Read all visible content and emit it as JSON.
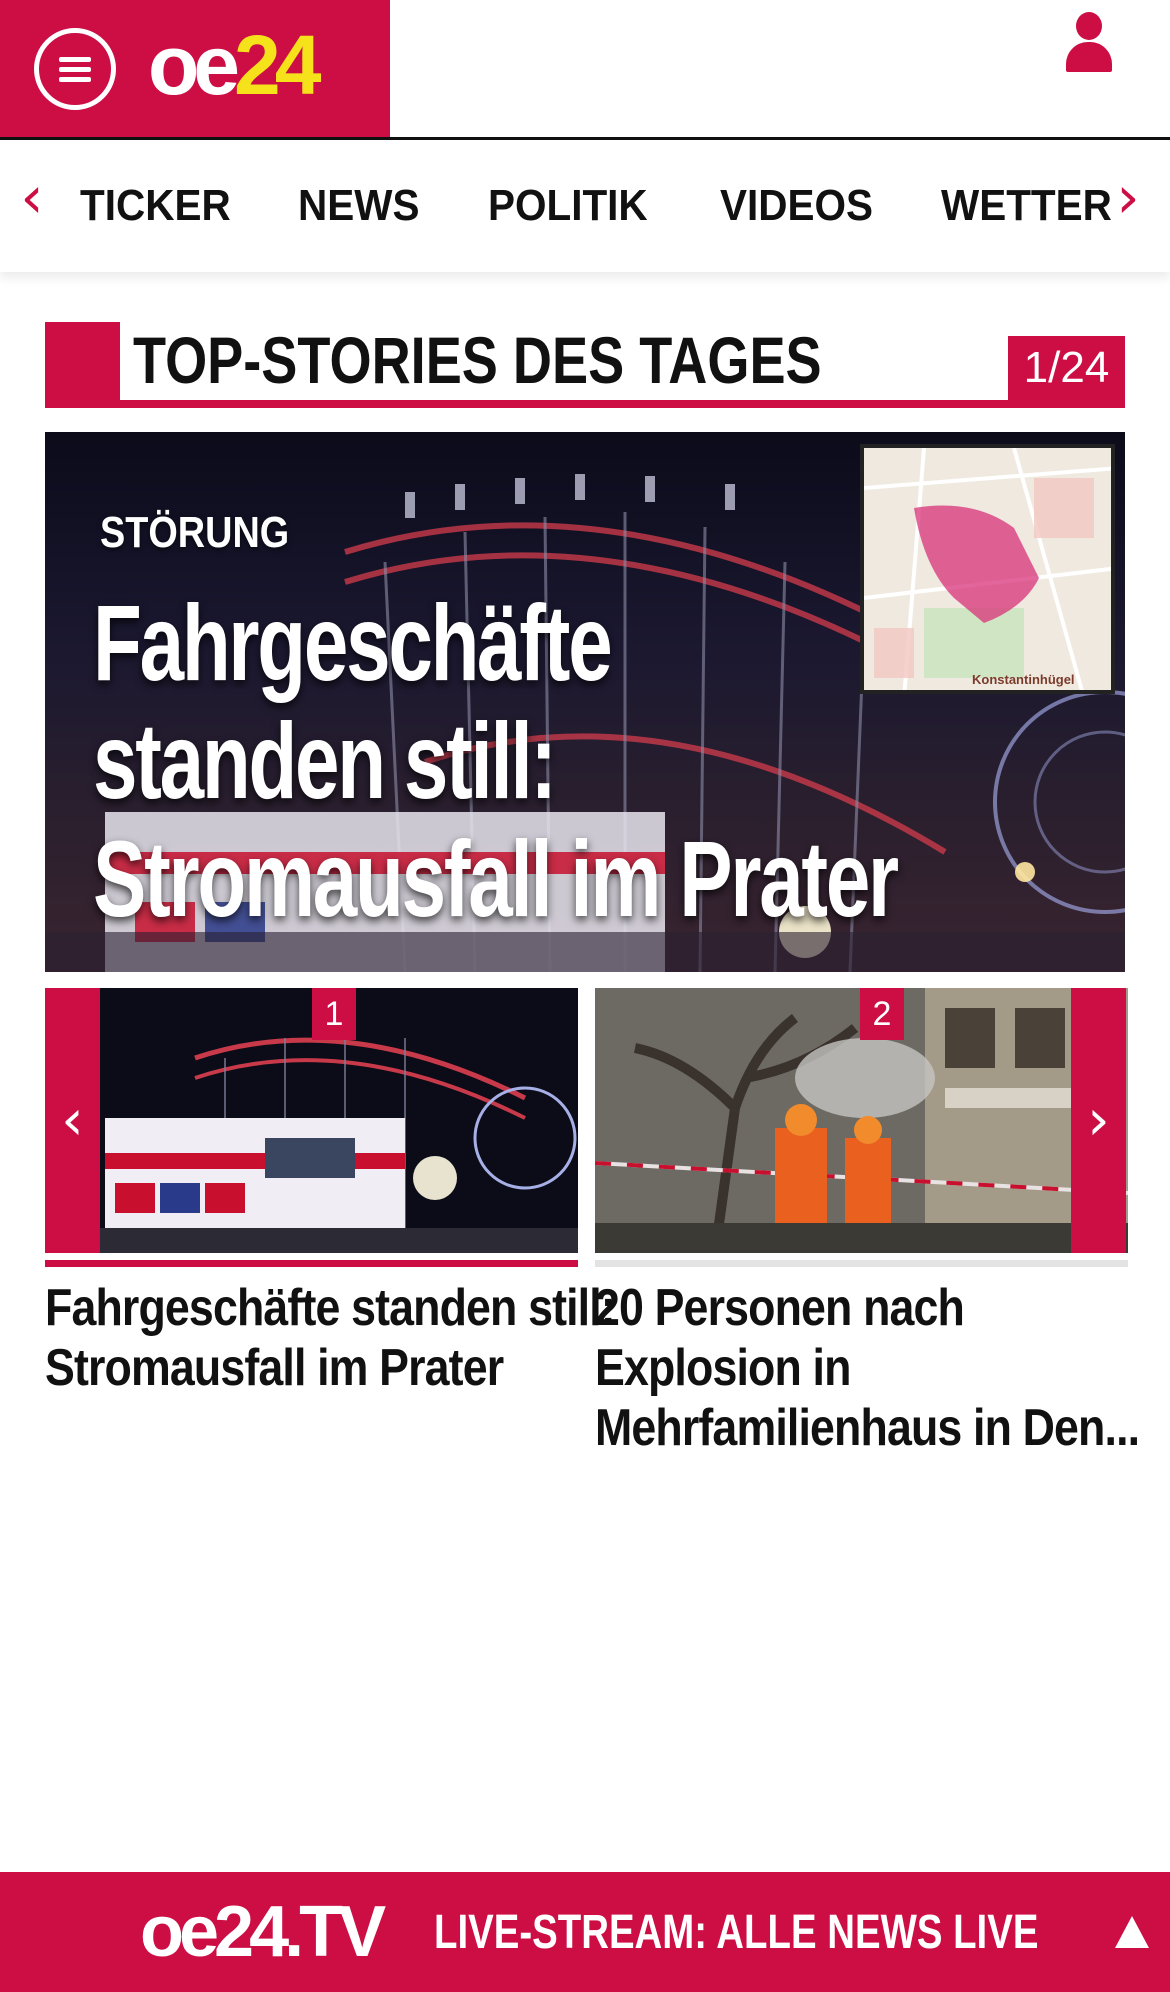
{
  "header": {
    "logo_oe": "oe",
    "logo_num": "24",
    "menu_icon": "hamburger-menu-icon",
    "user_icon": "user-icon",
    "brand_color": "#cc0e44",
    "logo_accent": "#f6e21b"
  },
  "nav": {
    "prev_icon": "chevron-left-icon",
    "next_icon": "chevron-right-icon",
    "prev_glyph": "‹",
    "next_glyph": "›",
    "items": [
      "TICKER",
      "NEWS",
      "POLITIK",
      "VIDEOS",
      "WETTER"
    ]
  },
  "section": {
    "title": "TOP-STORIES DES TAGES",
    "pager": "1/24"
  },
  "hero": {
    "kicker": "STÖRUNG",
    "title_lines": [
      "Fahrgeschäfte",
      "standen still:",
      "Stromausfall im Prater"
    ],
    "map_label": "Konstantinhügel"
  },
  "slider": {
    "prev_glyph": "‹",
    "next_glyph": "›",
    "cards": [
      {
        "badge": "1",
        "title_lines": [
          "Fahrgeschäfte standen still:",
          "Stromausfall im Prater"
        ]
      },
      {
        "badge": "2",
        "title_lines": [
          "20 Personen nach",
          "Explosion in",
          "Mehrfamilienhaus in Den..."
        ]
      }
    ]
  },
  "bottom_bar": {
    "tv_logo": "oe24.TV",
    "text": "LIVE-STREAM:  ALLE NEWS LIVE",
    "up_icon": "triangle-up-icon"
  }
}
